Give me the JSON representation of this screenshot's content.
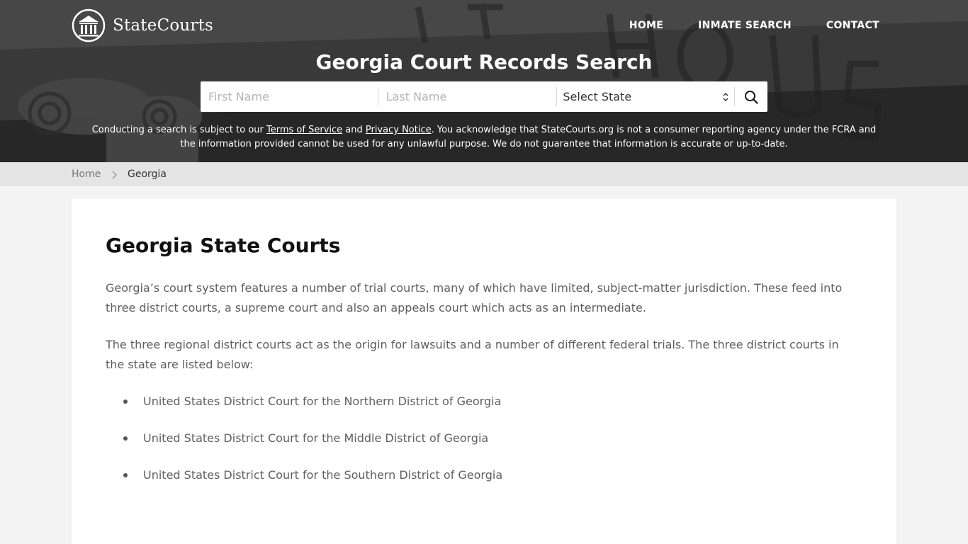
{
  "brand": {
    "name": "StateCourts"
  },
  "nav": {
    "items": [
      {
        "label": "HOME"
      },
      {
        "label": "INMATE SEARCH"
      },
      {
        "label": "CONTACT"
      }
    ]
  },
  "hero": {
    "title": "Georgia Court Records Search",
    "search": {
      "first_name_placeholder": "First Name",
      "last_name_placeholder": "Last Name",
      "state_select_value": "Select State",
      "submit_icon": "search-icon"
    },
    "disclaimer": {
      "part1": "Conducting a search is subject to our ",
      "terms_link": "Terms of Service",
      "part2": " and ",
      "privacy_link": "Privacy Notice",
      "part3": ". You acknowledge that StateCourts.org is not a consumer reporting agency under the FCRA and the information provided cannot be used for any unlawful purpose. We do not guarantee that information is accurate or up-to-date."
    }
  },
  "breadcrumb": {
    "home": "Home",
    "current": "Georgia",
    "separator_icon": "chevron-right-icon"
  },
  "main": {
    "title": "Georgia State Courts",
    "paragraphs": [
      "Georgia’s court system features a number of trial courts, many of which have limited, subject-matter jurisdiction. These feed into three district courts, a supreme court and also an appeals court which acts as an intermediate.",
      "The three regional district courts act as the origin for lawsuits and a number of different federal trials. The three district courts in the state are listed below:"
    ],
    "courts": [
      "United States District Court for the Northern District of Georgia",
      "United States District Court for the Middle District of Georgia",
      "United States District Court for the Southern District of Georgia"
    ]
  },
  "colors": {
    "hero_overlay": "#3d3d3d",
    "page_background": "#f4f4f4",
    "breadcrumb_background": "#e4e4e4",
    "card_background": "#ffffff",
    "heading_text": "#111111",
    "body_text": "#5e5e5e"
  }
}
